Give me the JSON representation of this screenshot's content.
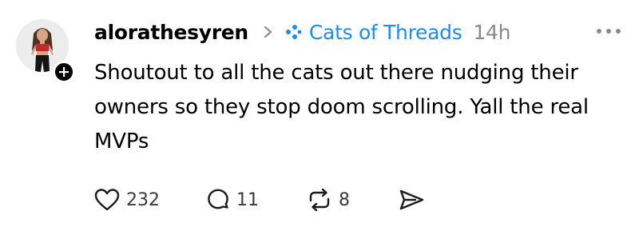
{
  "post": {
    "username": "alorathesyren",
    "community": "Cats of Threads",
    "timestamp": "14h",
    "text": "Shoutout to all the cats out there nudging their owners so they stop doom scrolling. Yall the real MVPs",
    "actions": {
      "like_count": "232",
      "reply_count": "11",
      "repost_count": "8"
    }
  },
  "icons": {
    "avatar": "profile-photo",
    "follow": "plus-icon",
    "separator": "chevron-right-icon",
    "community": "community-dots-icon",
    "more": "more-horizontal-icon",
    "like": "heart-icon",
    "reply": "comment-icon",
    "repost": "repost-icon",
    "share": "send-icon"
  },
  "colors": {
    "community_link": "#1d8cf5",
    "timestamp": "#8a8a8a",
    "text": "#000000"
  }
}
